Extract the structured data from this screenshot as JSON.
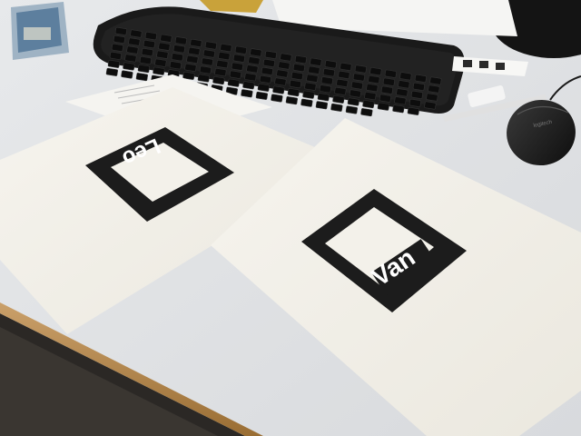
{
  "scene": {
    "description_free": true,
    "marker_left": {
      "label": "Leo"
    },
    "marker_right": {
      "label": "Van"
    },
    "mouse_brand": "logitech",
    "colors": {
      "desk": "#e4e6e8",
      "desk_edge": "#b98a4a",
      "paper": "#f3f1ea",
      "marker": "#1c1c1c",
      "keyboard": "#1a1a1a",
      "floor": "#2e2a26"
    },
    "icons": [
      "keyboard-icon",
      "mouse-icon",
      "marker-icon"
    ]
  }
}
